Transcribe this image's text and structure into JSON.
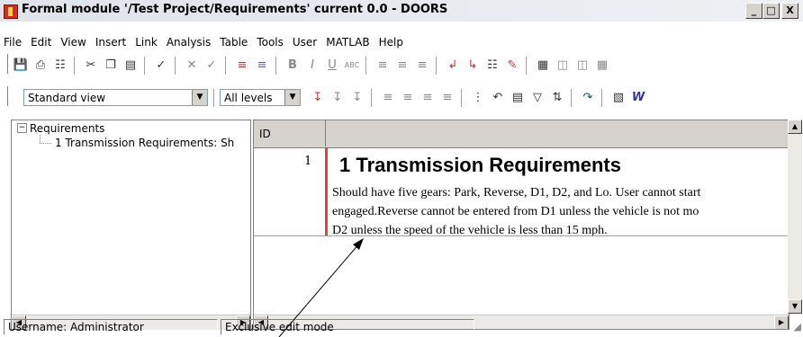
{
  "window": {
    "title": "Formal module '/Test Project/Requirements' current 0.0 - DOORS",
    "buttons": {
      "minimize": "_",
      "maximize": "□",
      "close": "X"
    }
  },
  "menu": [
    "File",
    "Edit",
    "View",
    "Insert",
    "Link",
    "Analysis",
    "Table",
    "Tools",
    "User",
    "MATLAB",
    "Help"
  ],
  "toolbar2": {
    "view_select": "Standard view",
    "level_select": "All levels"
  },
  "tree": {
    "root": "Requirements",
    "expander": "−",
    "child": "1 Transmission Requirements: Sh"
  },
  "grid": {
    "column_id": "ID",
    "row": {
      "id": "1",
      "heading": "1 Transmission Requirements",
      "lines": [
        "Should have five gears: Park, Reverse, D1, D2, and Lo. User cannot start",
        "engaged.Reverse cannot be entered from D1 unless the vehicle is not mo",
        "D2 unless the speed of the vehicle is less than 15 mph."
      ]
    }
  },
  "status": {
    "user": "Username: Administrator",
    "mode": "Exclusive edit mode"
  },
  "colors": {
    "accent": "#e0453a",
    "chrome": "#d6d3ce"
  }
}
